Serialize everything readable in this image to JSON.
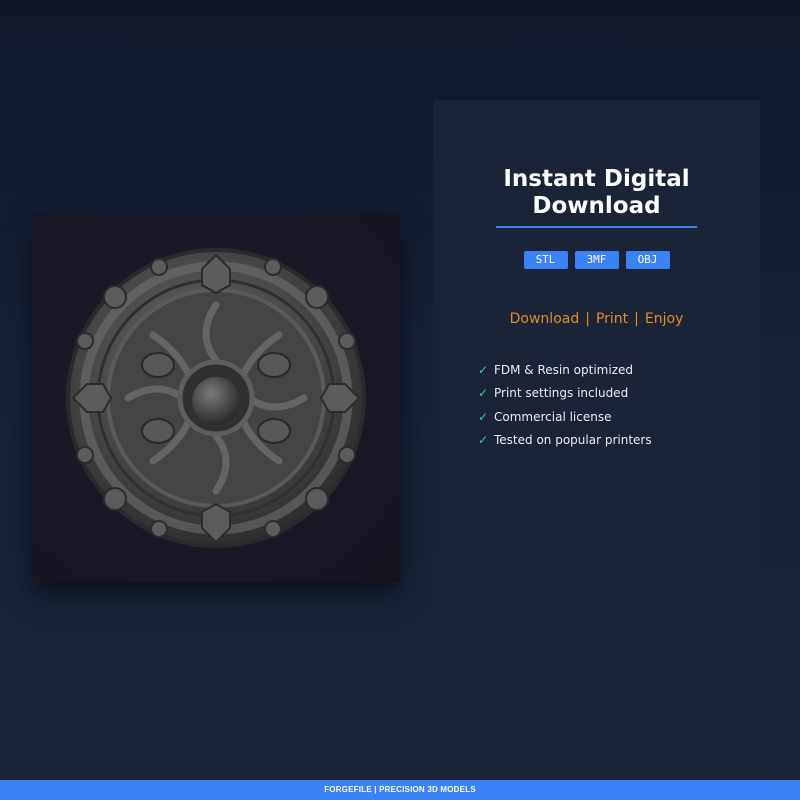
{
  "panel": {
    "title_line1": "Instant Digital",
    "title_line2": "Download",
    "formats": [
      "STL",
      "3MF",
      "OBJ"
    ],
    "steps": [
      "Download",
      "Print",
      "Enjoy"
    ],
    "step_separator": "|",
    "features": [
      "FDM & Resin optimized",
      "Print settings included",
      "Commercial license",
      "Tested on popular printers"
    ],
    "check_glyph": "✓"
  },
  "footer": {
    "brand": "FORGEFILE",
    "separator": "|",
    "tagline": "PRECISION 3D MODELS"
  },
  "product": {
    "image_alt_icon": "ornate-shield-model-icon"
  },
  "colors": {
    "accent": "#3b82f6",
    "steps": "#e08b2c",
    "check": "#2fd2a6",
    "panel": "#1a2436"
  }
}
